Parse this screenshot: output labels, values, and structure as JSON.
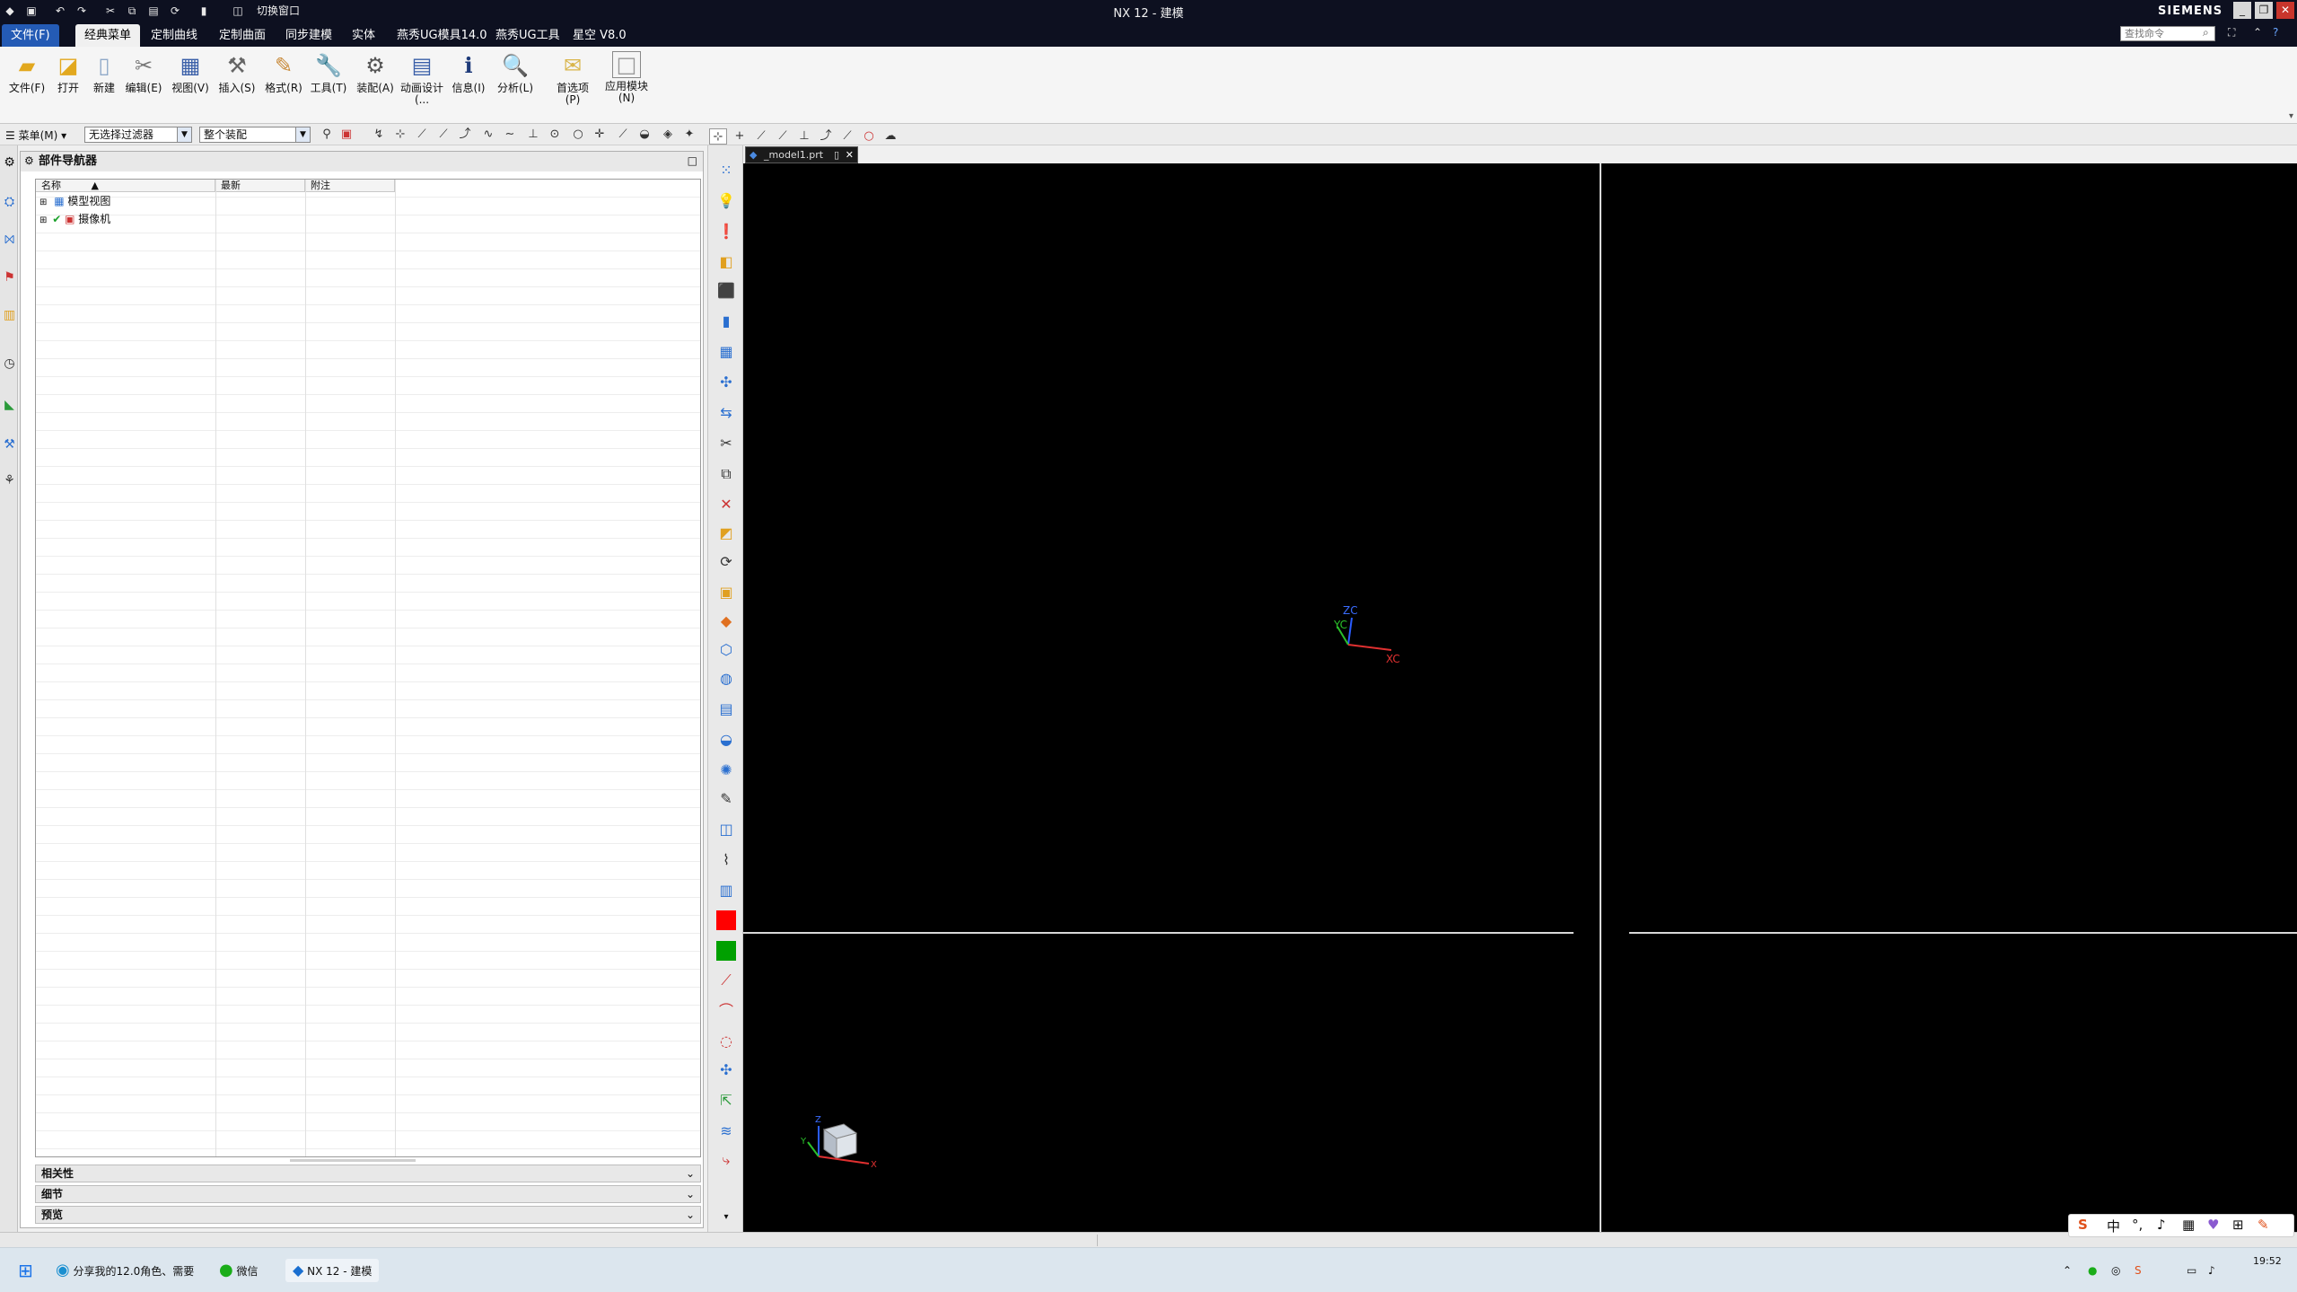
{
  "window": {
    "title": "NX 12 - 建模",
    "switch_window": "切换窗口",
    "brand": "SIEMENS"
  },
  "menu_tabs": [
    "文件(F)",
    "经典菜单",
    "定制曲线",
    "定制曲面",
    "同步建模",
    "实体",
    "燕秀UG模具14.0",
    "燕秀UG工具",
    "星空 V8.0"
  ],
  "search": {
    "placeholder": "查找命令"
  },
  "ribbon": [
    {
      "label": "文件(F)",
      "icon": "folder-icon"
    },
    {
      "label": "打开",
      "icon": "open-folder-icon"
    },
    {
      "label": "新建",
      "icon": "new-document-icon"
    },
    {
      "label": "编辑(E)",
      "icon": "edit-tools-icon"
    },
    {
      "label": "视图(V)",
      "icon": "view-icon"
    },
    {
      "label": "插入(S)",
      "icon": "insert-icon"
    },
    {
      "label": "格式(R)",
      "icon": "format-icon"
    },
    {
      "label": "工具(T)",
      "icon": "wrench-icon"
    },
    {
      "label": "装配(A)",
      "icon": "assembly-icon"
    },
    {
      "label": "动画设计(...",
      "icon": "animation-icon"
    },
    {
      "label": "信息(I)",
      "icon": "info-icon"
    },
    {
      "label": "分析(L)",
      "icon": "analysis-icon"
    },
    {
      "label": "首选项(P)",
      "icon": "preferences-icon"
    },
    {
      "label": "应用模块(N)",
      "icon": "application-icon"
    }
  ],
  "selbar": {
    "menu": "菜单(M)",
    "filter": "无选择过滤器",
    "scope": "整个装配"
  },
  "navigator": {
    "title": "部件导航器",
    "columns": [
      "名称",
      "最新",
      "附注"
    ],
    "rows": [
      {
        "label": "模型视图",
        "icon": "model-views-icon"
      },
      {
        "label": "摄像机",
        "icon": "camera-icon"
      }
    ],
    "sections": [
      "相关性",
      "细节",
      "预览"
    ]
  },
  "document_tab": {
    "label": "_model1.prt"
  },
  "viewport": {
    "triad": {
      "zc": "ZC",
      "yc": "YC",
      "xc": "XC"
    },
    "mini_axes": {
      "z": "Z",
      "y": "Y",
      "x": "X"
    }
  },
  "taskbar": {
    "items": [
      "分享我的12.0角色、需要",
      "微信",
      "NX 12 - 建模"
    ],
    "clock_time": "19:52"
  },
  "colors": {
    "viewport_bg": "#000000",
    "title_bg": "#0d1020",
    "file_tab": "#245bb5",
    "red_square": "#ff0000",
    "green_square": "#00a000"
  }
}
